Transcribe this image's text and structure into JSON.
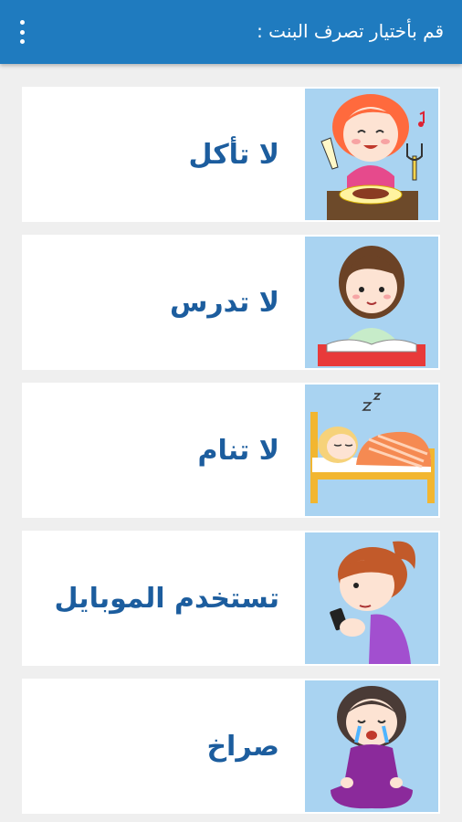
{
  "appbar": {
    "title": "قم بأختيار تصرف البنت :",
    "menu_icon": "more-vert-icon"
  },
  "options": [
    {
      "label": "لا تأكل",
      "image": "girl-eating-icon"
    },
    {
      "label": "لا تدرس",
      "image": "girl-studying-icon"
    },
    {
      "label": "لا تنام",
      "image": "girl-sleeping-icon"
    },
    {
      "label": "تستخدم الموبايل",
      "image": "girl-using-phone-icon"
    },
    {
      "label": "صراخ",
      "image": "girl-crying-icon"
    }
  ],
  "colors": {
    "appbar": "#1f7bbf",
    "background": "#efefef",
    "label_text": "#1c5d9e",
    "thumb_background": "#a9d3f1"
  }
}
